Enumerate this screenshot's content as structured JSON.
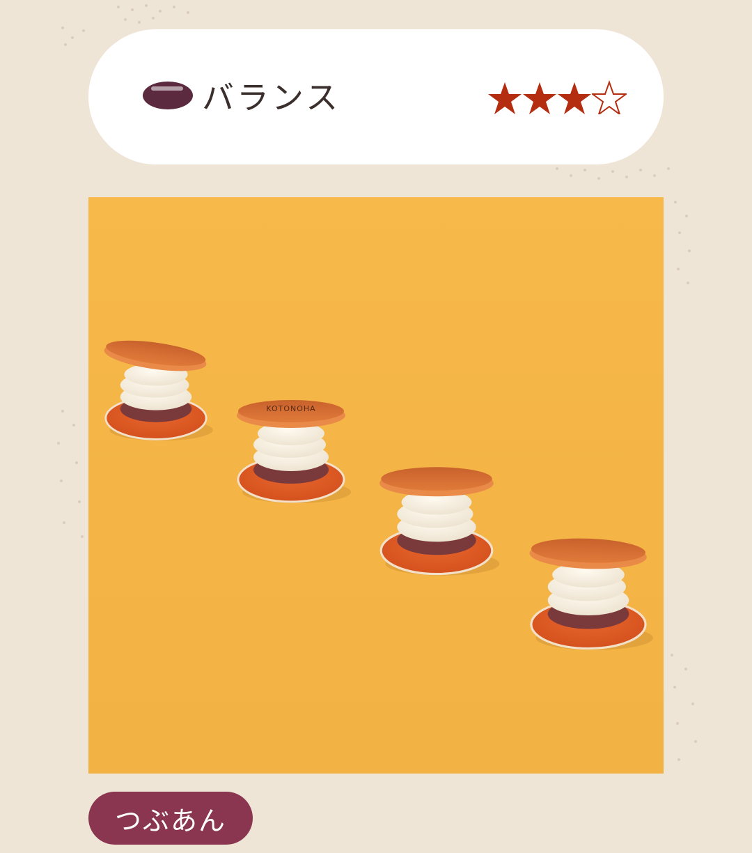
{
  "header": {
    "icon": "bean-icon",
    "label": "バランス",
    "rating": {
      "value": 3,
      "max": 5,
      "filled_color": "#b42d10",
      "empty_color": "#b42d10"
    }
  },
  "photo": {
    "description_icon": "dorayaki-photo",
    "items": [
      {
        "name": "dorayaki-1"
      },
      {
        "name": "dorayaki-2",
        "stamp": "KOTONOHA"
      },
      {
        "name": "dorayaki-3"
      },
      {
        "name": "dorayaki-4"
      }
    ]
  },
  "tag": {
    "label": "つぶあん",
    "color": "#8a3650"
  },
  "colors": {
    "background": "#efe5d7",
    "photo_bg": "#f5b647",
    "card": "#ffffff"
  }
}
